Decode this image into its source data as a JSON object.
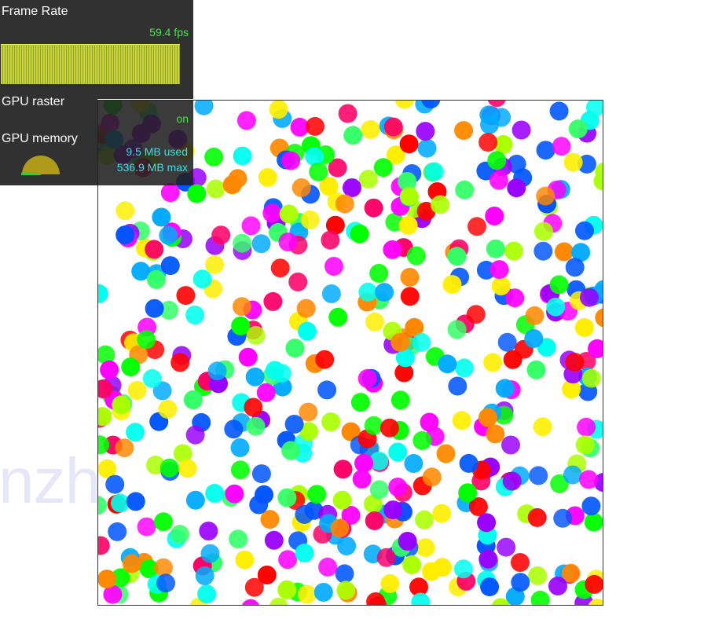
{
  "hud": {
    "frame_rate_title": "Frame Rate",
    "frame_rate_value": "59.4 fps",
    "gpu_raster_title": "GPU raster",
    "gpu_raster_status": "on",
    "gpu_memory_title": "GPU memory",
    "gpu_memory_used": "9.5 MB used",
    "gpu_memory_max": "536.9 MB max",
    "gpu_memory_fraction": 0.018
  },
  "watermark": "nzhixiang",
  "colors": {
    "hud_background": "#202020",
    "fps_text": "#3aee3a",
    "memory_text": "#2ee6ee",
    "graph_bar": "#c8d43a",
    "gauge_fill": "#b09a1a"
  },
  "dots": {
    "palette": [
      "#ff00ff",
      "#00ff00",
      "#ff0000",
      "#9900ff",
      "#0055ff",
      "#ff8800",
      "#00ffee",
      "#ffee00",
      "#33ff66",
      "#aaff00",
      "#00aaff",
      "#ff0066"
    ],
    "count": 520
  }
}
